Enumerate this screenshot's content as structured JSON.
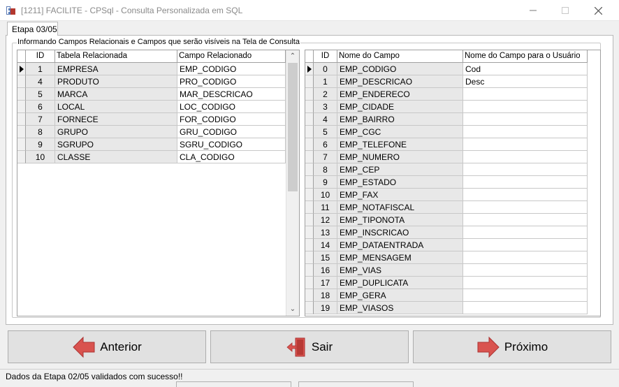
{
  "window": {
    "title": "[1211] FACILITE - CPSql - Consulta Personalizada em SQL",
    "minimize_icon": "minimize-icon",
    "maximize_icon": "maximize-icon",
    "close_icon": "close-icon"
  },
  "tab": {
    "label": "Etapa 03/05"
  },
  "group": {
    "caption": "Informando Campos Relacionais e Campos que serão visíveis na Tela de Consulta"
  },
  "left_grid": {
    "headers": [
      "ID",
      "Tabela Relacionada",
      "Campo Relacionado"
    ],
    "selected_row": 0,
    "rows": [
      [
        "1",
        "EMPRESA",
        "EMP_CODIGO"
      ],
      [
        "4",
        "PRODUTO",
        "PRO_CODIGO"
      ],
      [
        "5",
        "MARCA",
        "MAR_DESCRICAO"
      ],
      [
        "6",
        "LOCAL",
        "LOC_CODIGO"
      ],
      [
        "7",
        "FORNECE",
        "FOR_CODIGO"
      ],
      [
        "8",
        "GRUPO",
        "GRU_CODIGO"
      ],
      [
        "9",
        "SGRUPO",
        "SGRU_CODIGO"
      ],
      [
        "10",
        "CLASSE",
        "CLA_CODIGO"
      ]
    ]
  },
  "right_grid": {
    "headers": [
      "ID",
      "Nome do Campo",
      "Nome do Campo para o Usuário"
    ],
    "selected_row": 0,
    "rows": [
      [
        "0",
        "EMP_CODIGO",
        "Cod"
      ],
      [
        "1",
        "EMP_DESCRICAO",
        "Desc"
      ],
      [
        "2",
        "EMP_ENDERECO",
        ""
      ],
      [
        "3",
        "EMP_CIDADE",
        ""
      ],
      [
        "4",
        "EMP_BAIRRO",
        ""
      ],
      [
        "5",
        "EMP_CGC",
        ""
      ],
      [
        "6",
        "EMP_TELEFONE",
        ""
      ],
      [
        "7",
        "EMP_NUMERO",
        ""
      ],
      [
        "8",
        "EMP_CEP",
        ""
      ],
      [
        "9",
        "EMP_ESTADO",
        ""
      ],
      [
        "10",
        "EMP_FAX",
        ""
      ],
      [
        "11",
        "EMP_NOTAFISCAL",
        ""
      ],
      [
        "12",
        "EMP_TIPONOTA",
        ""
      ],
      [
        "13",
        "EMP_INSCRICAO",
        ""
      ],
      [
        "14",
        "EMP_DATAENTRADA",
        ""
      ],
      [
        "15",
        "EMP_MENSAGEM",
        ""
      ],
      [
        "16",
        "EMP_VIAS",
        ""
      ],
      [
        "17",
        "EMP_DUPLICATA",
        ""
      ],
      [
        "18",
        "EMP_GERA",
        ""
      ],
      [
        "19",
        "EMP_VIASOS",
        ""
      ]
    ]
  },
  "buttons": {
    "prev_label": "Anterior",
    "exit_label": "Sair",
    "next_label": "Próximo",
    "prev_icon": "left-arrow-icon",
    "exit_icon": "exit-door-icon",
    "next_icon": "right-arrow-icon"
  },
  "status": {
    "text": "Dados da Etapa 02/05 validados com sucesso!!"
  },
  "colors": {
    "arrow_red": "#d9534f",
    "grid_border": "#a0a0a0",
    "readonly_cell": "#e8e8e8"
  }
}
